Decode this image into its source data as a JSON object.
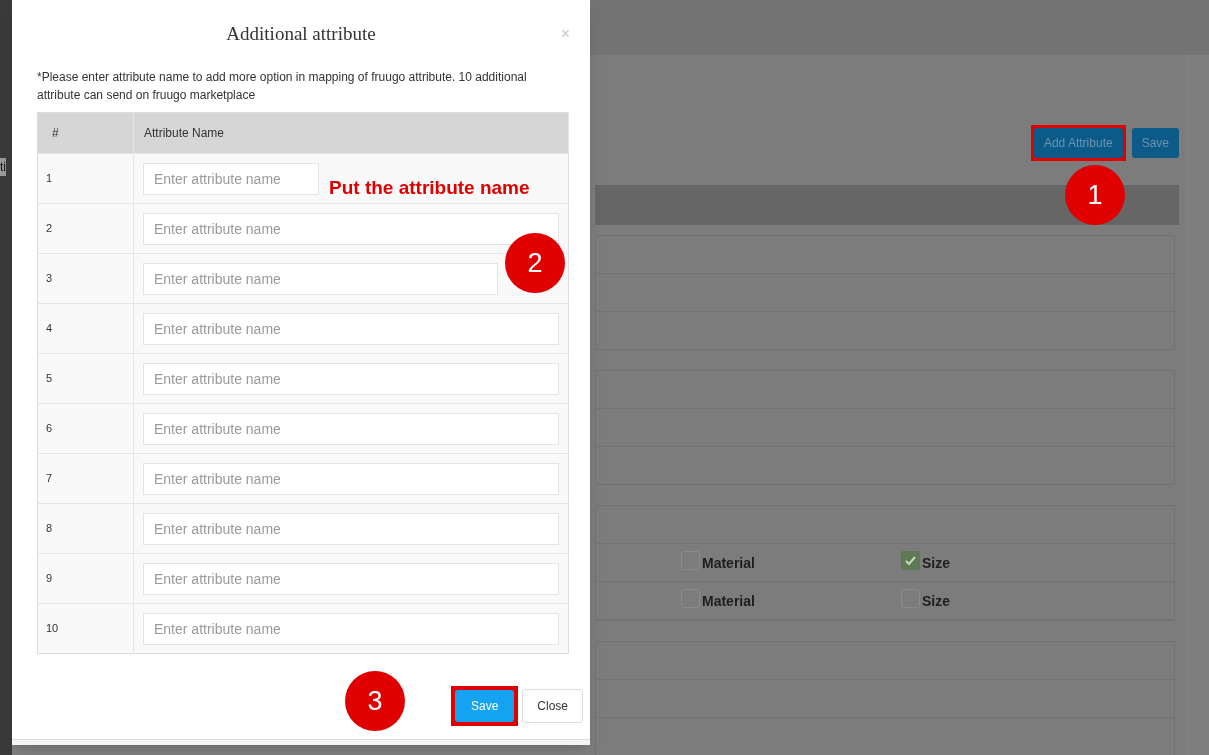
{
  "background": {
    "fragment": "ti",
    "buttons": [
      {
        "label": "Add Attribute",
        "highlighted": true
      },
      {
        "label": "Save",
        "highlighted": false
      }
    ],
    "option_rows": [
      {
        "options": [
          {
            "label": "Material",
            "checked": false
          },
          {
            "label": "Size",
            "checked": true
          }
        ]
      },
      {
        "options": [
          {
            "label": "Material",
            "checked": false
          },
          {
            "label": "Size",
            "checked": false
          }
        ]
      }
    ]
  },
  "modal": {
    "title": "Additional attribute",
    "close": "×",
    "note": "*Please enter attribute name to add more option in mapping of fruugo attribute. 10 additional attribute can send on fruugo marketplace",
    "columns": [
      "#",
      "Attribute Name"
    ],
    "rows": [
      {
        "number": "1",
        "placeholder": "Enter attribute name"
      },
      {
        "number": "2",
        "placeholder": "Enter attribute name"
      },
      {
        "number": "3",
        "placeholder": "Enter attribute name"
      },
      {
        "number": "4",
        "placeholder": "Enter attribute name"
      },
      {
        "number": "5",
        "placeholder": "Enter attribute name"
      },
      {
        "number": "6",
        "placeholder": "Enter attribute name"
      },
      {
        "number": "7",
        "placeholder": "Enter attribute name"
      },
      {
        "number": "8",
        "placeholder": "Enter attribute name"
      },
      {
        "number": "9",
        "placeholder": "Enter attribute name"
      },
      {
        "number": "10",
        "placeholder": "Enter attribute name"
      }
    ],
    "buttons": [
      {
        "label": "Save",
        "kind": "primary",
        "highlighted": true
      },
      {
        "label": "Close",
        "kind": "default",
        "highlighted": false
      }
    ]
  },
  "callout": "Put the attribute name",
  "step_markers": [
    "1",
    "2",
    "3"
  ]
}
